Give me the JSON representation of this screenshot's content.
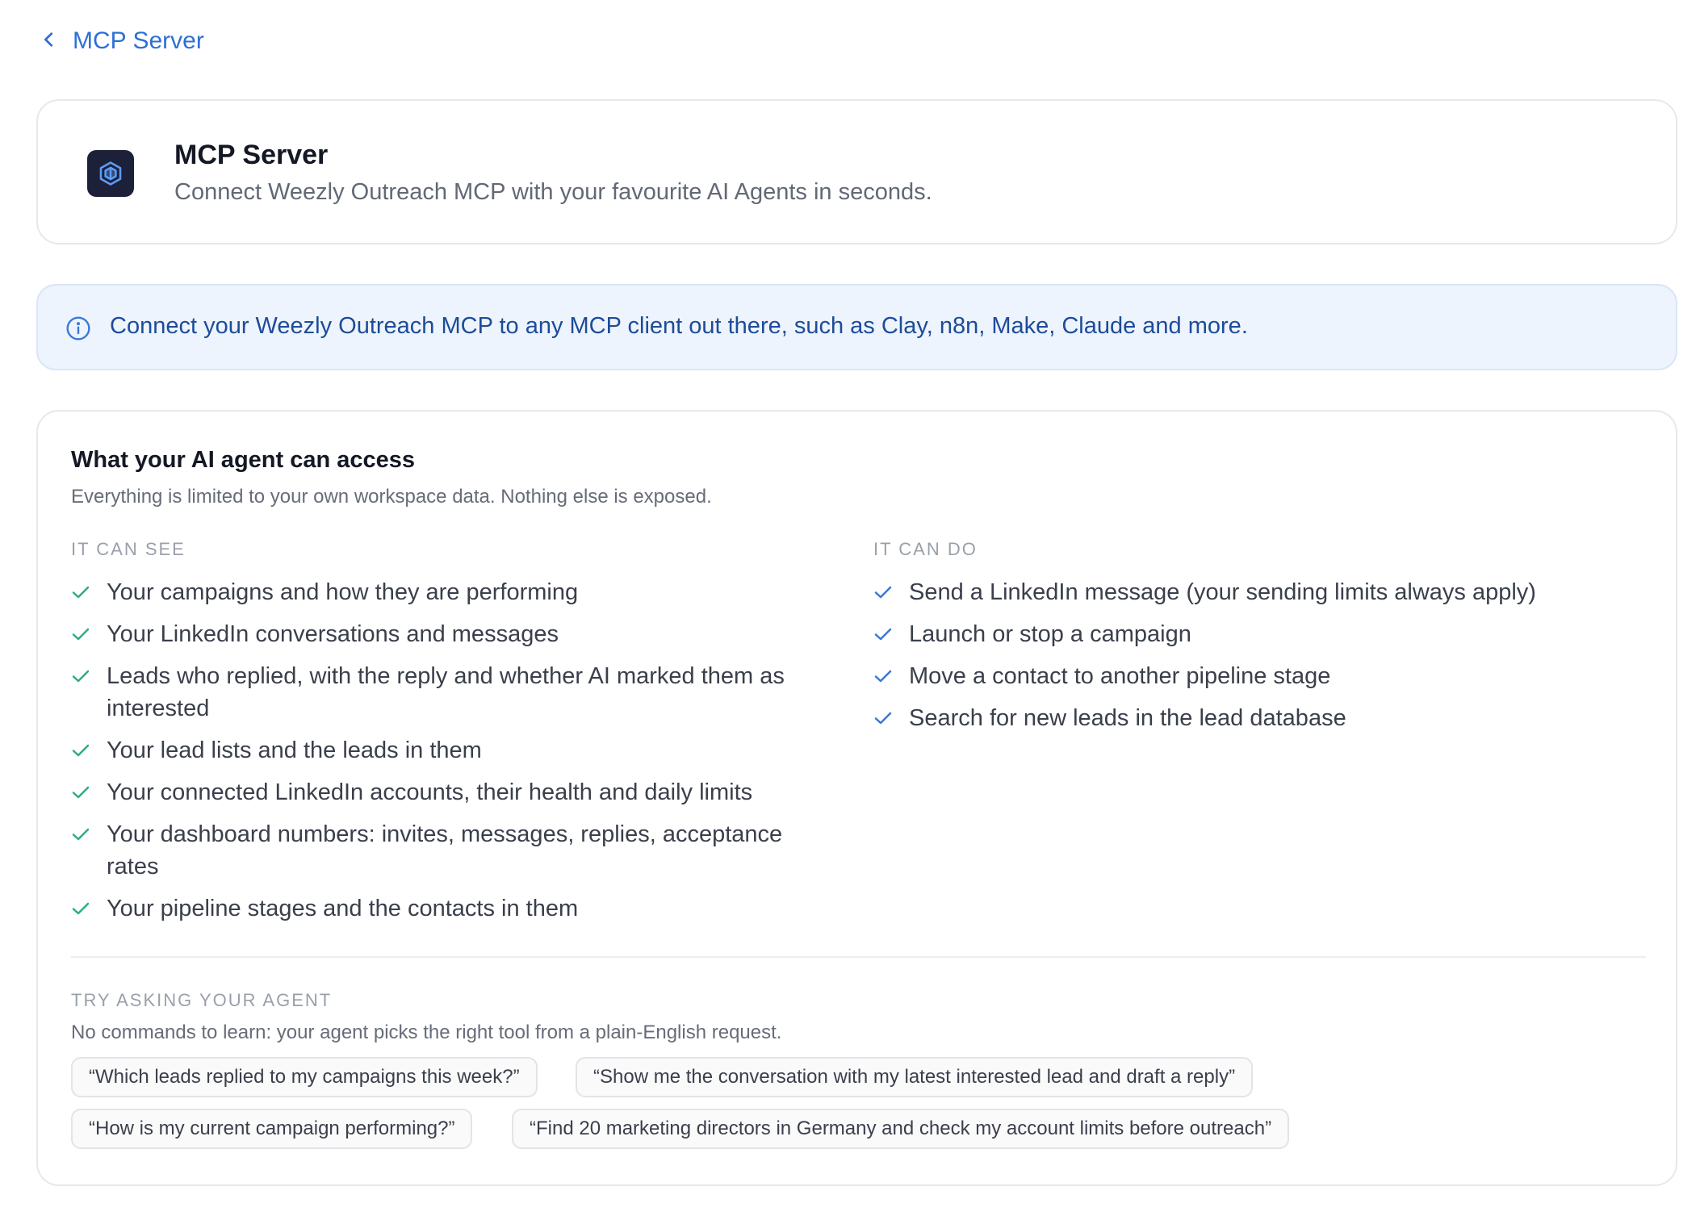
{
  "nav": {
    "back_label": "MCP Server"
  },
  "header": {
    "title": "MCP Server",
    "subtitle": "Connect Weezly Outreach MCP with your favourite AI Agents in seconds."
  },
  "info_banner": {
    "text": "Connect your Weezly Outreach MCP to any MCP client out there, such as Clay, n8n, Make, Claude and more."
  },
  "access": {
    "title": "What your AI agent can access",
    "subtitle": "Everything is limited to your own workspace data. Nothing else is exposed.",
    "can_see": {
      "heading": "IT CAN SEE",
      "items": [
        "Your campaigns and how they are performing",
        "Your LinkedIn conversations and messages",
        "Leads who replied, with the reply and whether AI marked them as interested",
        "Your lead lists and the leads in them",
        "Your connected LinkedIn accounts, their health and daily limits",
        "Your dashboard numbers: invites, messages, replies, acceptance rates",
        "Your pipeline stages and the contacts in them"
      ]
    },
    "can_do": {
      "heading": "IT CAN DO",
      "items": [
        "Send a LinkedIn message (your sending limits always apply)",
        "Launch or stop a campaign",
        "Move a contact to another pipeline stage",
        "Search for new leads in the lead database"
      ]
    },
    "try_asking": {
      "heading": "TRY ASKING YOUR AGENT",
      "subtitle": "No commands to learn: your agent picks the right tool from a plain-English request.",
      "prompts": [
        "“Which leads replied to my campaigns this week?”",
        "“Show me the conversation with my latest interested lead and draft a reply”",
        "“How is my current campaign performing?”",
        "“Find 20 marketing directors in Germany and check my account limits before outreach”"
      ]
    }
  },
  "colors": {
    "link": "#2f6fd6",
    "check_green": "#2eae7d",
    "check_blue": "#3a78d6",
    "info_bg": "#eef4fd",
    "info_text": "#1d4c99",
    "app_icon_bg": "#1d2039"
  },
  "icons": {
    "back": "chevron-left-icon",
    "app": "mcp-hexagon-icon",
    "info": "info-circle-icon",
    "see_check": "check-icon",
    "do_check": "check-icon"
  }
}
